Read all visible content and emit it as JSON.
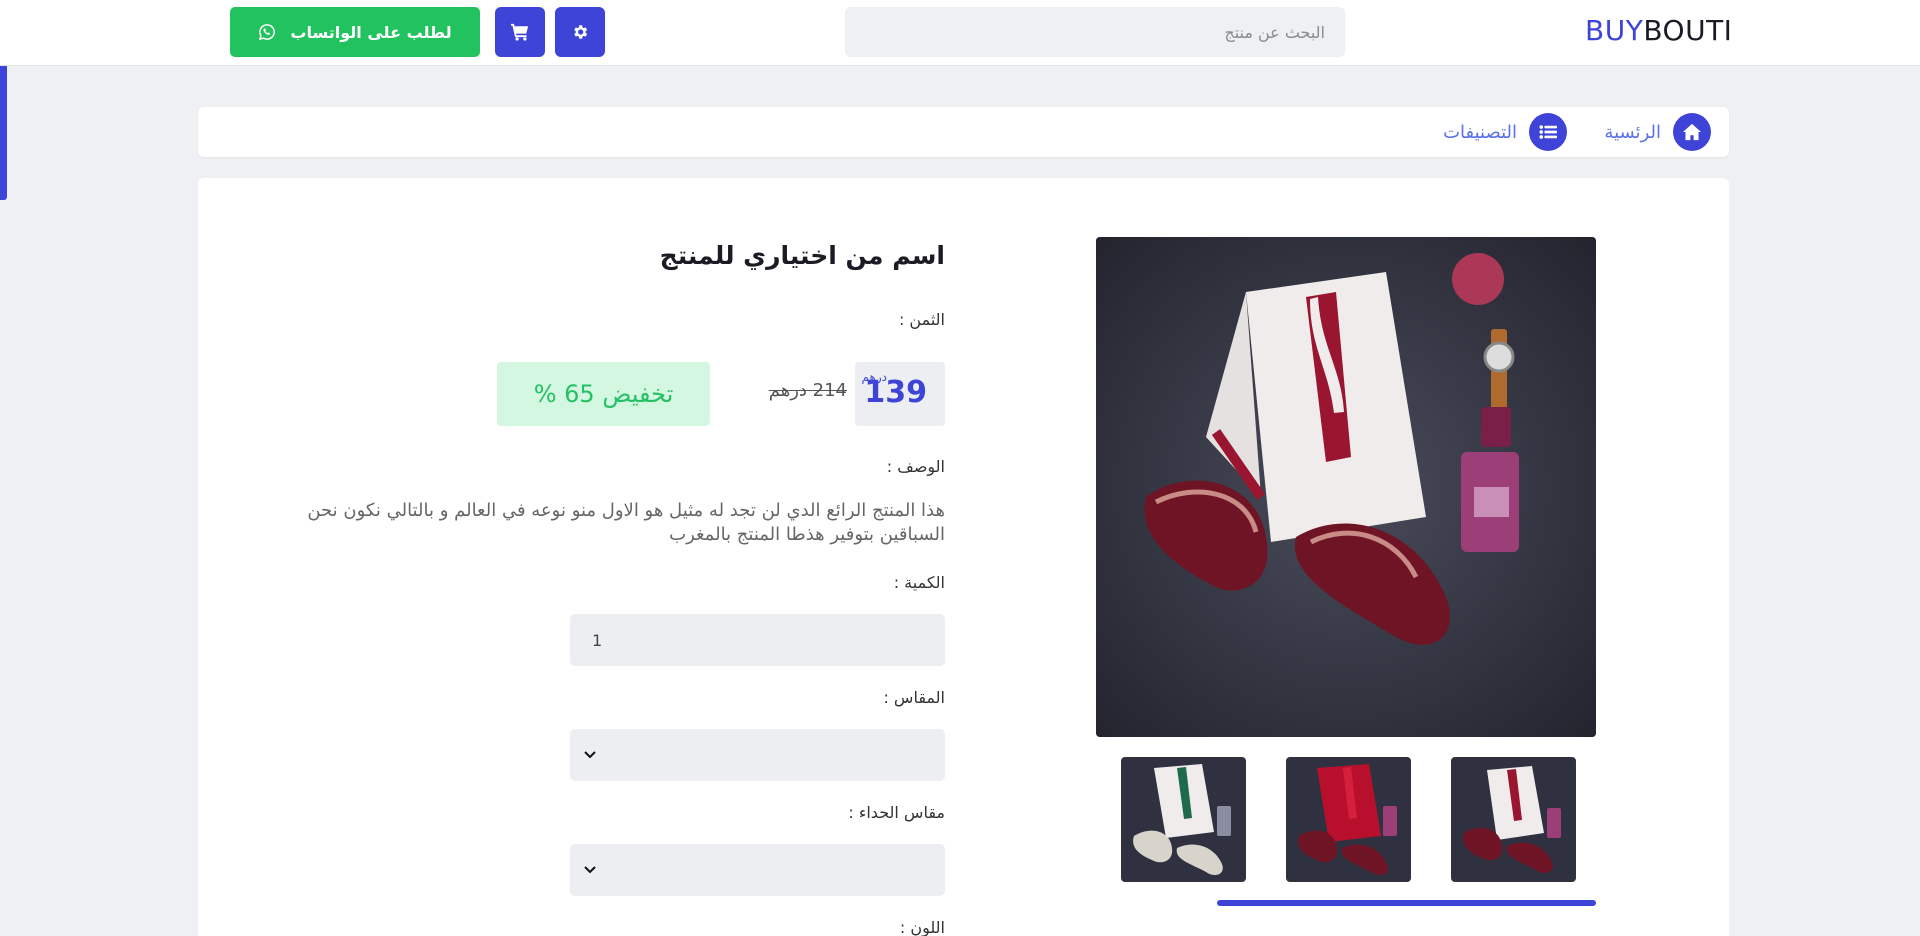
{
  "brand": {
    "part1": "BUY",
    "part2": "BOUTI"
  },
  "search": {
    "placeholder": "البحث عن منتج"
  },
  "header": {
    "whatsapp_label": "لطلب على الواتساب"
  },
  "breadcrumb": {
    "home": "الرئسية",
    "categories": "التصنيفات"
  },
  "product": {
    "title": "اسم من اختياري للمنتج",
    "price_label": "الثمن :",
    "price": "139",
    "currency": "درهم",
    "old_price": "214 درهم",
    "discount": "تخفيض 65 %",
    "description_label": "الوصف :",
    "description": "هذا المنتج الرائع الدي لن تجد له مثيل هو الاول منو نوعه في العالم و بالتالي نكون نحن السباقين بتوفير هذطا المنتج بالمغرب",
    "quantity_label": "الكمية :",
    "quantity": "1",
    "size_label": "المقاس :",
    "shoe_size_label": "مقاس الحداء :",
    "color_label": "اللون :"
  },
  "colors": {
    "accent": "#3f44d8",
    "whatsapp": "#22c35e",
    "discount_bg": "#d4f7e2",
    "discount_text": "#24c063"
  },
  "icons": {
    "gear": "gear-icon",
    "cart": "cart-icon",
    "whatsapp": "whatsapp-icon",
    "home": "home-icon",
    "list": "list-icon",
    "chevron": "chevron-down-icon"
  }
}
